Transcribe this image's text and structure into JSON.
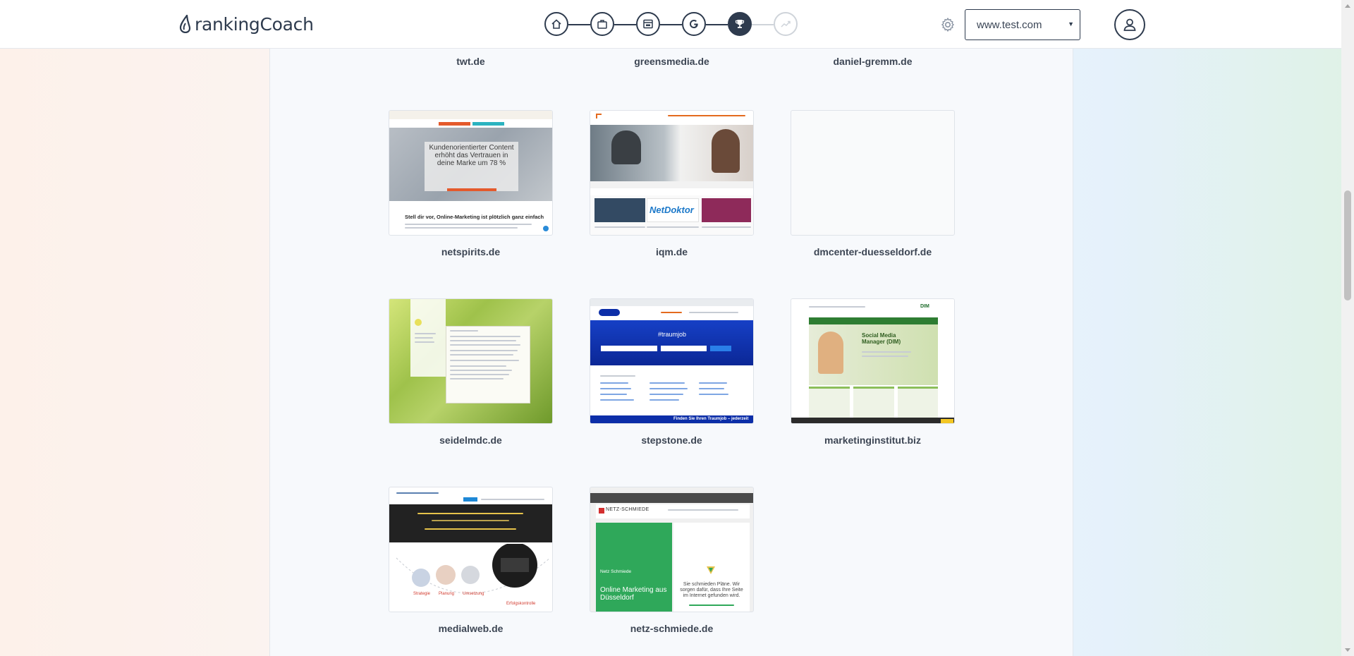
{
  "app": {
    "brand": "rankingCoach",
    "domain_selected": "www.test.com"
  },
  "steps": [
    {
      "name": "home",
      "state": "done"
    },
    {
      "name": "business",
      "state": "done"
    },
    {
      "name": "website",
      "state": "done"
    },
    {
      "name": "google",
      "state": "done"
    },
    {
      "name": "competitors",
      "state": "active"
    },
    {
      "name": "growth",
      "state": "disabled"
    }
  ],
  "competitors": {
    "top_row": [
      "twt.de",
      "greensmedia.de",
      "daniel-gremm.de"
    ],
    "tiles": [
      {
        "domain": "netspirits.de",
        "headline": "Kundenorientierter Content erhöht das Vertrauen in deine Marke um 78 %",
        "subline": "Stell dir vor, Online-Marketing ist plötzlich ganz einfach"
      },
      {
        "domain": "iqm.de",
        "partner": "NetDoktor"
      },
      {
        "domain": "dmcenter-duesseldorf.de"
      },
      {
        "domain": "seidelmdc.de"
      },
      {
        "domain": "stepstone.de",
        "hero": "#traumjob",
        "footer": "Finden Sie Ihren Traumjob – jederzeit"
      },
      {
        "domain": "marketinginstitut.biz",
        "logo": "DIM",
        "hero": "Social Media Manager (DIM)"
      },
      {
        "domain": "medialweb.de",
        "labels": [
          "Strategie",
          "Planung",
          "Umsetzung",
          "Erfolgskontrolle"
        ]
      },
      {
        "domain": "netz-schmiede.de",
        "brand": "NETZ-SCHMIEDE",
        "hero_small": "Netz Schmiede",
        "hero": "Online Marketing aus Düsseldorf",
        "tagline": "Sie schmieden Pläne. Wir sorgen dafür, dass Ihre Seite im Internet gefunden wird."
      }
    ]
  },
  "colors": {
    "primary": "#2e3b4e",
    "panel": "#f7f9fc",
    "netz_green": "#2fa85a",
    "stepstone_blue": "#0c2ea8",
    "seidel_green": "#8dbb3a"
  }
}
